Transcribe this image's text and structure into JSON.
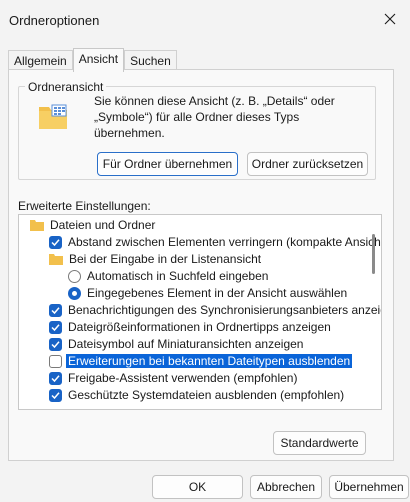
{
  "window": {
    "title": "Ordneroptionen"
  },
  "tabs": [
    {
      "label": "Allgemein"
    },
    {
      "label": "Ansicht"
    },
    {
      "label": "Suchen"
    }
  ],
  "folder_view": {
    "group_title": "Ordneransicht",
    "description_line1": "Sie können diese Ansicht (z. B. „Details“ oder",
    "description_line2": "„Symbole“) für alle Ordner dieses Typs übernehmen.",
    "apply_button": "Für Ordner übernehmen",
    "reset_button": "Ordner zurücksetzen"
  },
  "advanced": {
    "label": "Erweiterte Einstellungen:",
    "items": [
      {
        "type": "folder",
        "label": "Dateien und Ordner"
      },
      {
        "type": "checkbox",
        "checked": true,
        "label": "Abstand zwischen Elementen verringern (kompakte Ansicht)"
      },
      {
        "type": "folder",
        "label": "Bei der Eingabe in der Listenansicht"
      },
      {
        "type": "radio",
        "checked": false,
        "label": "Automatisch in Suchfeld eingeben"
      },
      {
        "type": "radio",
        "checked": true,
        "label": "Eingegebenes Element in der Ansicht auswählen"
      },
      {
        "type": "checkbox",
        "checked": true,
        "label": "Benachrichtigungen des Synchronisierungsanbieters anzeigen"
      },
      {
        "type": "checkbox",
        "checked": true,
        "label": "Dateigrößeinformationen in Ordnertipps anzeigen"
      },
      {
        "type": "checkbox",
        "checked": true,
        "label": "Dateisymbol auf Miniaturansichten anzeigen"
      },
      {
        "type": "checkbox",
        "checked": false,
        "selected": true,
        "label": "Erweiterungen bei bekannten Dateitypen ausblenden"
      },
      {
        "type": "checkbox",
        "checked": true,
        "label": "Freigabe-Assistent verwenden (empfohlen)"
      },
      {
        "type": "checkbox",
        "checked": true,
        "label": "Geschützte Systemdateien ausblenden (empfohlen)"
      }
    ],
    "defaults_button": "Standardwerte"
  },
  "footer": {
    "ok_button": "OK",
    "cancel_button": "Abbrechen",
    "apply_button": "Übernehmen"
  },
  "colors": {
    "accent": "#1963c6",
    "selection": "#0a64d8",
    "folder": "#f2c04c"
  }
}
